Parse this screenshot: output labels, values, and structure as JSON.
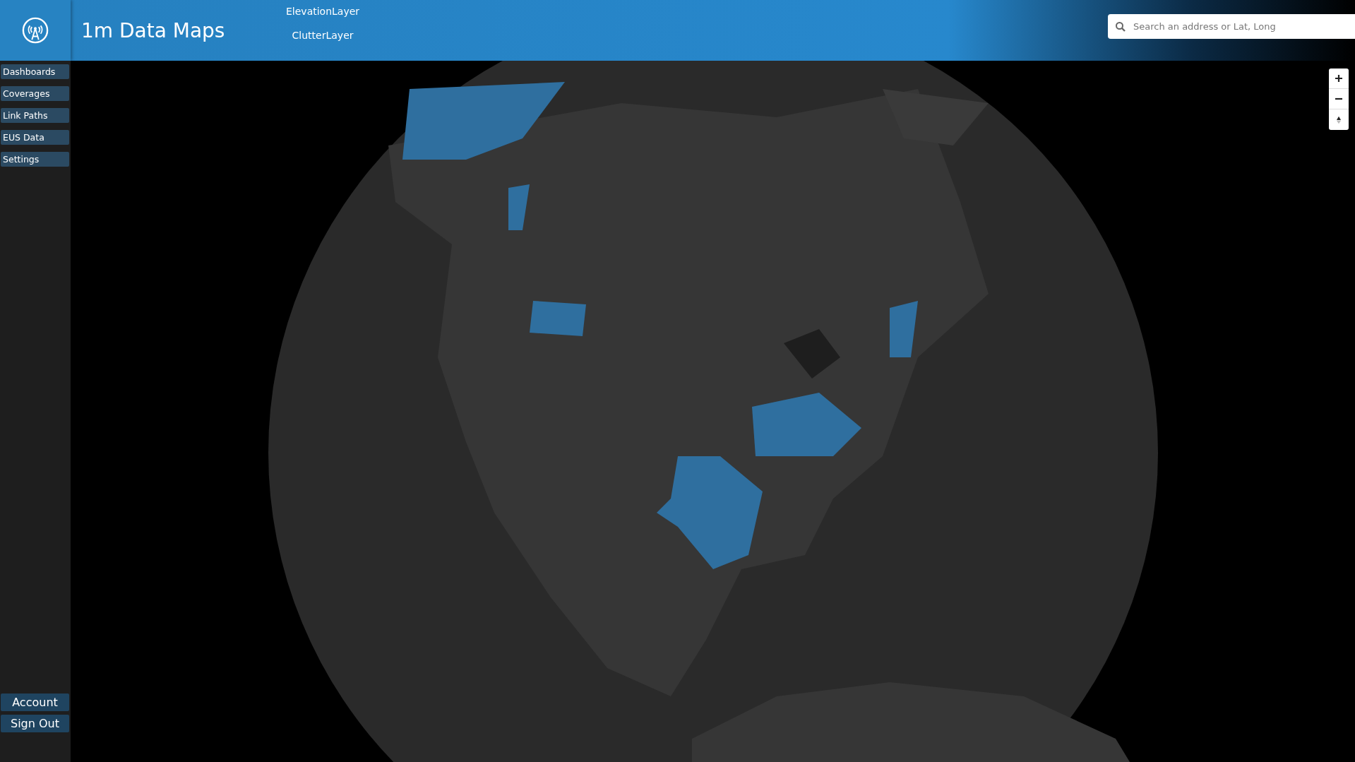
{
  "header": {
    "title": "1m Data Maps",
    "layers": [
      {
        "label": "ElevationLayer"
      },
      {
        "label": "ClutterLayer"
      }
    ],
    "search": {
      "placeholder": "Search an address or Lat, Long"
    }
  },
  "sidebar": {
    "items": [
      {
        "label": "Dashboards"
      },
      {
        "label": "Coverages"
      },
      {
        "label": "Link Paths"
      },
      {
        "label": "EUS Data"
      },
      {
        "label": "Settings"
      }
    ],
    "bottom": [
      {
        "label": "Account"
      },
      {
        "label": "Sign Out"
      }
    ]
  }
}
